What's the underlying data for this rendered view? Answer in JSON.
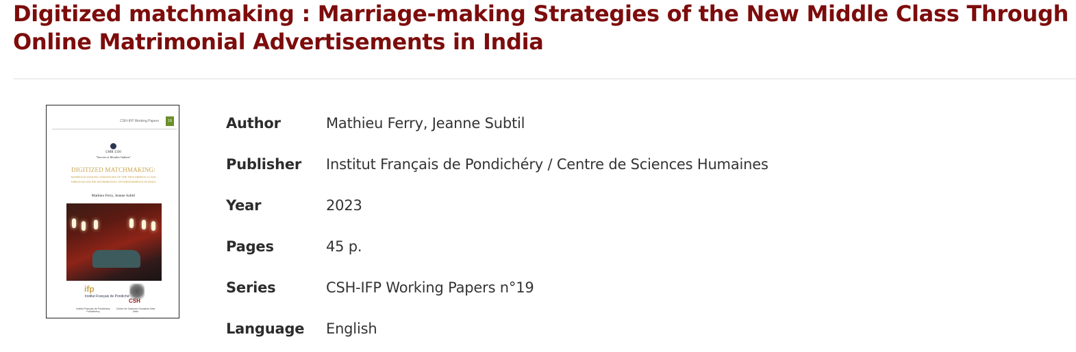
{
  "title": "Digitized matchmaking : Marriage-making Strategies of the New Middle Class Through Online Matrimonial Advertisements in India",
  "cover": {
    "band_text": "CSH-IFP Working Papers",
    "band_number": "19",
    "umr_line1": "UMR 3330",
    "umr_line2": "\"Savoirs et Mondes Indiens\"",
    "title_main": "DIGITIZED MATCHMAKING:",
    "title_sub1": "MARRIAGE-MAKING STRATEGIES OF THE NEW MIDDLE CLASS",
    "title_sub2": "THROUGH ONLINE MATRIMONIAL ADVERTISEMENTS IN INDIA",
    "authors": "Mathieu Ferry, Jeanne Subtil",
    "logo_left": "ifp",
    "logo_left_sub": "Institut Français de Pondichéry",
    "logo_right": "CSH",
    "fine_left": "Institut Français de Pondichéry Pondicherry",
    "fine_right": "Centre de Sciences Humaines New Delhi"
  },
  "metadata": [
    {
      "label": "Author",
      "value": "Mathieu Ferry, Jeanne Subtil"
    },
    {
      "label": "Publisher",
      "value": "Institut Français de Pondichéry / Centre de Sciences Humaines"
    },
    {
      "label": "Year",
      "value": "2023"
    },
    {
      "label": "Pages",
      "value": "45 p."
    },
    {
      "label": "Series",
      "value": "CSH-IFP Working Papers n°19"
    },
    {
      "label": "Language",
      "value": "English"
    }
  ],
  "colors": {
    "title": "#7d0c0c",
    "label": "#2c2c2c",
    "value": "#333333",
    "divider": "#eeeeee"
  }
}
